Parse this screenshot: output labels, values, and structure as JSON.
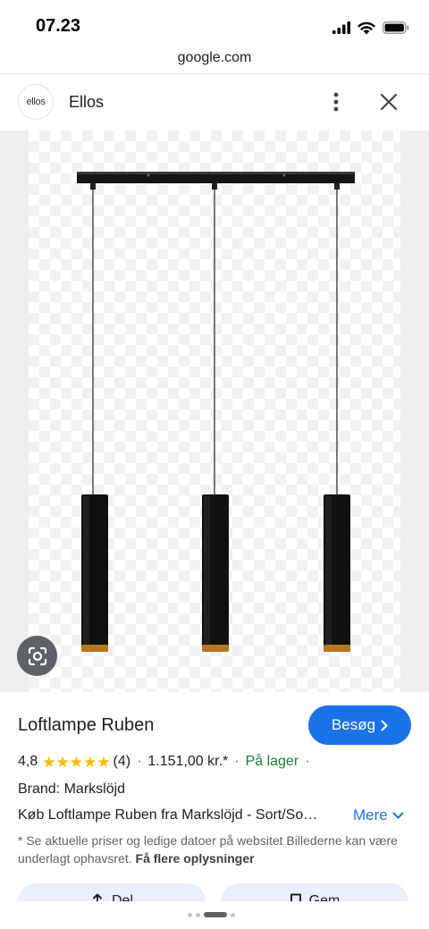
{
  "status_bar": {
    "time": "07.23"
  },
  "browser": {
    "url": "google.com"
  },
  "site": {
    "logo_text": "ellos",
    "name": "Ellos",
    "more_icon": "more-vert-icon",
    "close_icon": "close-icon"
  },
  "image": {
    "alt": "Loftlampe Ruben product image",
    "lens_icon": "google-lens-icon"
  },
  "product": {
    "title": "Loftlampe Ruben",
    "visit_label": "Besøg",
    "rating": "4,8",
    "stars": 4.8,
    "review_count": "(4)",
    "price": "1.151,00 kr.*",
    "stock": "På lager",
    "brand": "Brand: Markslöjd",
    "description": "Køb Loftlampe Ruben fra Markslöjd - Sort/So…",
    "more_label": "Mere",
    "disclaimer": "* Se aktuelle priser og ledige datoer på websitet Billederne kan være underlagt ophavsret.",
    "disclaimer_link": "Få flere oplysninger"
  },
  "actions": [
    {
      "label": "Del",
      "icon": "share-icon"
    },
    {
      "label": "Gem",
      "icon": "bookmark-icon"
    }
  ],
  "colors": {
    "accent": "#1a73e8",
    "star": "#fbbc04",
    "stock": "#188038"
  }
}
